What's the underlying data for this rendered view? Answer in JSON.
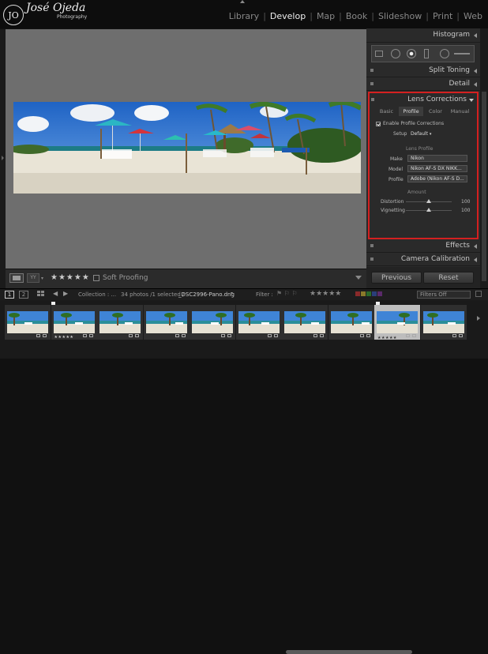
{
  "logo": {
    "mark": "JO",
    "name": "José Ojeda",
    "sub": "Photography"
  },
  "modules": [
    "Library",
    "Develop",
    "Map",
    "Book",
    "Slideshow",
    "Print",
    "Web"
  ],
  "active_module": "Develop",
  "panels": {
    "histogram": "Histogram",
    "split_toning": "Split Toning",
    "detail": "Detail",
    "lens_corrections": "Lens Corrections",
    "effects": "Effects",
    "camera_calibration": "Camera Calibration"
  },
  "lens": {
    "tabs": [
      "Basic",
      "Profile",
      "Color",
      "Manual"
    ],
    "active_tab": "Profile",
    "enable_label": "Enable Profile Corrections",
    "setup_label": "Setup",
    "setup_value": "Default",
    "section_profile": "Lens Profile",
    "make_label": "Make",
    "make_value": "Nikon",
    "model_label": "Model",
    "model_value": "Nikon AF-S DX NIKK...",
    "profile_label": "Profile",
    "profile_value": "Adobe (Nikon AF-S D...",
    "section_amount": "Amount",
    "distortion_label": "Distortion",
    "distortion_value": "100",
    "vignetting_label": "Vignetting",
    "vignetting_value": "100"
  },
  "buttons": {
    "previous": "Previous",
    "reset": "Reset"
  },
  "toolbar": {
    "stars": "★★★★★",
    "soft_proofing": "Soft Proofing",
    "view_yy": "YY"
  },
  "filmbar": {
    "page1": "1",
    "page2": "2",
    "collection": "Collection : ...",
    "count": "34 photos /1 selected /",
    "filename": "_DSC2996-Pano.dng",
    "filter_label": "Filter :",
    "filters_off": "Filters Off"
  },
  "filmstrip": {
    "selected_index": 8,
    "thumbs": 10,
    "stars": "★★★★★"
  }
}
